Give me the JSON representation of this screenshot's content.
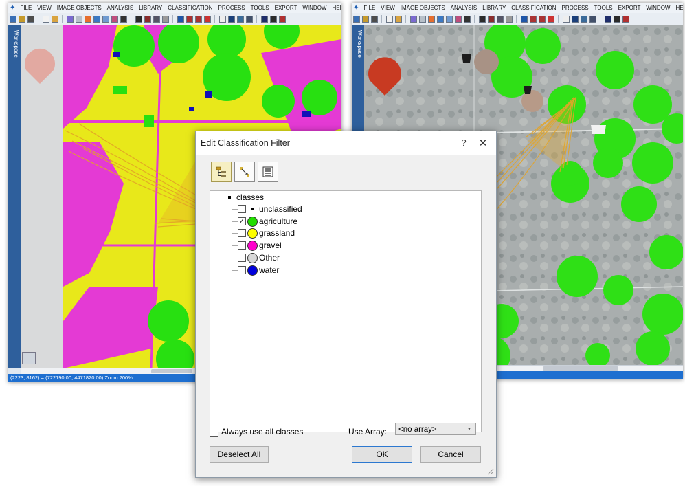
{
  "app": {
    "menu": [
      "FILE",
      "VIEW",
      "IMAGE OBJECTS",
      "ANALYSIS",
      "LIBRARY",
      "CLASSIFICATION",
      "PROCESS",
      "TOOLS",
      "EXPORT",
      "WINDOW",
      "HELP"
    ],
    "workspace_label": "Workspace",
    "status_text": "(2223, 8162) = (722190.00, 4471820.00)  Zoom:200%"
  },
  "dialog": {
    "title": "Edit Classification Filter",
    "help_glyph": "?",
    "close_glyph": "✕",
    "tree": {
      "root": "classes",
      "items": [
        {
          "label": "unclassified",
          "checked": false,
          "color": null
        },
        {
          "label": "agriculture",
          "checked": true,
          "color": "#22dd00"
        },
        {
          "label": "grassland",
          "checked": false,
          "color": "#ffff00"
        },
        {
          "label": "gravel",
          "checked": false,
          "color": "#ff00cc"
        },
        {
          "label": "Other",
          "checked": false,
          "color": "#d8d8d8"
        },
        {
          "label": "water",
          "checked": false,
          "color": "#0000dd"
        }
      ]
    },
    "always_use_all_classes": "Always use all classes",
    "use_array_label": "Use Array:",
    "use_array_value": "<no array>",
    "deselect_all": "Deselect All",
    "ok": "OK",
    "cancel": "Cancel"
  }
}
